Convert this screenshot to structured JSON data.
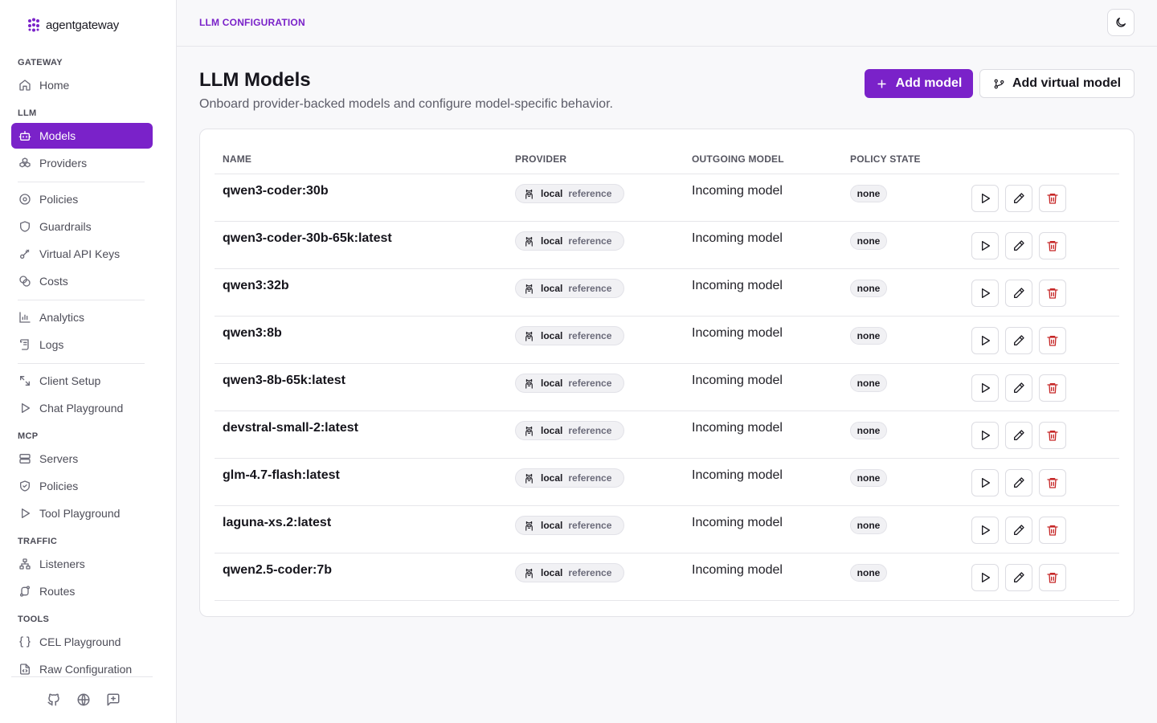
{
  "brand": {
    "name": "agentgateway"
  },
  "sidebar": {
    "sections": {
      "gateway": "GATEWAY",
      "llm": "LLM",
      "mcp": "MCP",
      "traffic": "TRAFFIC",
      "tools": "TOOLS"
    },
    "items": [
      {
        "label": "Home",
        "icon": "home-icon"
      },
      {
        "label": "Models",
        "icon": "bot-icon",
        "active": true
      },
      {
        "label": "Providers",
        "icon": "boxes-icon"
      },
      {
        "label": "Policies",
        "icon": "settings-circle-icon"
      },
      {
        "label": "Guardrails",
        "icon": "shield-icon"
      },
      {
        "label": "Virtual API Keys",
        "icon": "key-icon"
      },
      {
        "label": "Costs",
        "icon": "coins-icon"
      },
      {
        "label": "Analytics",
        "icon": "bar-chart-icon"
      },
      {
        "label": "Logs",
        "icon": "scroll-icon"
      },
      {
        "label": "Client Setup",
        "icon": "tools-icon"
      },
      {
        "label": "Chat Playground",
        "icon": "play-icon"
      },
      {
        "label": "Servers",
        "icon": "server-icon"
      },
      {
        "label": "Policies",
        "icon": "shield-check-icon"
      },
      {
        "label": "Tool Playground",
        "icon": "play-icon"
      },
      {
        "label": "Listeners",
        "icon": "network-icon"
      },
      {
        "label": "Routes",
        "icon": "route-icon"
      },
      {
        "label": "CEL Playground",
        "icon": "braces-icon"
      },
      {
        "label": "Raw Configuration",
        "icon": "file-code-icon"
      }
    ]
  },
  "header": {
    "breadcrumb": "LLM CONFIGURATION"
  },
  "main": {
    "title": "LLM Models",
    "subtitle": "Onboard provider-backed models and configure model-specific behavior.",
    "add_model_label": "Add model",
    "add_virtual_label": "Add virtual model"
  },
  "table": {
    "columns": [
      "NAME",
      "PROVIDER",
      "OUTGOING MODEL",
      "POLICY STATE"
    ],
    "rows": [
      {
        "name": "qwen3-coder:30b",
        "provider": "local",
        "provider_tag": "reference",
        "outgoing": "Incoming model",
        "policy": "none"
      },
      {
        "name": "qwen3-coder-30b-65k:latest",
        "provider": "local",
        "provider_tag": "reference",
        "outgoing": "Incoming model",
        "policy": "none"
      },
      {
        "name": "qwen3:32b",
        "provider": "local",
        "provider_tag": "reference",
        "outgoing": "Incoming model",
        "policy": "none"
      },
      {
        "name": "qwen3:8b",
        "provider": "local",
        "provider_tag": "reference",
        "outgoing": "Incoming model",
        "policy": "none"
      },
      {
        "name": "qwen3-8b-65k:latest",
        "provider": "local",
        "provider_tag": "reference",
        "outgoing": "Incoming model",
        "policy": "none"
      },
      {
        "name": "devstral-small-2:latest",
        "provider": "local",
        "provider_tag": "reference",
        "outgoing": "Incoming model",
        "policy": "none"
      },
      {
        "name": "glm-4.7-flash:latest",
        "provider": "local",
        "provider_tag": "reference",
        "outgoing": "Incoming model",
        "policy": "none"
      },
      {
        "name": "laguna-xs.2:latest",
        "provider": "local",
        "provider_tag": "reference",
        "outgoing": "Incoming model",
        "policy": "none"
      },
      {
        "name": "qwen2.5-coder:7b",
        "provider": "local",
        "provider_tag": "reference",
        "outgoing": "Incoming model",
        "policy": "none"
      }
    ]
  },
  "colors": {
    "accent": "#7a22c9",
    "danger": "#c62828"
  }
}
